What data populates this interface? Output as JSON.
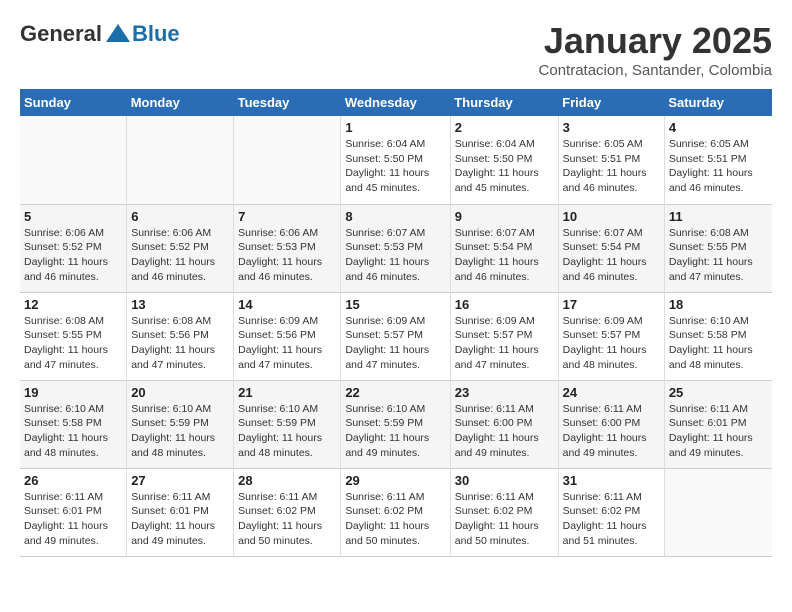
{
  "header": {
    "logo_text_general": "General",
    "logo_text_blue": "Blue",
    "title": "January 2025",
    "subtitle": "Contratacion, Santander, Colombia"
  },
  "days_of_week": [
    "Sunday",
    "Monday",
    "Tuesday",
    "Wednesday",
    "Thursday",
    "Friday",
    "Saturday"
  ],
  "weeks": [
    [
      {
        "day": "",
        "info": ""
      },
      {
        "day": "",
        "info": ""
      },
      {
        "day": "",
        "info": ""
      },
      {
        "day": "1",
        "info": "Sunrise: 6:04 AM\nSunset: 5:50 PM\nDaylight: 11 hours and 45 minutes."
      },
      {
        "day": "2",
        "info": "Sunrise: 6:04 AM\nSunset: 5:50 PM\nDaylight: 11 hours and 45 minutes."
      },
      {
        "day": "3",
        "info": "Sunrise: 6:05 AM\nSunset: 5:51 PM\nDaylight: 11 hours and 46 minutes."
      },
      {
        "day": "4",
        "info": "Sunrise: 6:05 AM\nSunset: 5:51 PM\nDaylight: 11 hours and 46 minutes."
      }
    ],
    [
      {
        "day": "5",
        "info": "Sunrise: 6:06 AM\nSunset: 5:52 PM\nDaylight: 11 hours and 46 minutes."
      },
      {
        "day": "6",
        "info": "Sunrise: 6:06 AM\nSunset: 5:52 PM\nDaylight: 11 hours and 46 minutes."
      },
      {
        "day": "7",
        "info": "Sunrise: 6:06 AM\nSunset: 5:53 PM\nDaylight: 11 hours and 46 minutes."
      },
      {
        "day": "8",
        "info": "Sunrise: 6:07 AM\nSunset: 5:53 PM\nDaylight: 11 hours and 46 minutes."
      },
      {
        "day": "9",
        "info": "Sunrise: 6:07 AM\nSunset: 5:54 PM\nDaylight: 11 hours and 46 minutes."
      },
      {
        "day": "10",
        "info": "Sunrise: 6:07 AM\nSunset: 5:54 PM\nDaylight: 11 hours and 46 minutes."
      },
      {
        "day": "11",
        "info": "Sunrise: 6:08 AM\nSunset: 5:55 PM\nDaylight: 11 hours and 47 minutes."
      }
    ],
    [
      {
        "day": "12",
        "info": "Sunrise: 6:08 AM\nSunset: 5:55 PM\nDaylight: 11 hours and 47 minutes."
      },
      {
        "day": "13",
        "info": "Sunrise: 6:08 AM\nSunset: 5:56 PM\nDaylight: 11 hours and 47 minutes."
      },
      {
        "day": "14",
        "info": "Sunrise: 6:09 AM\nSunset: 5:56 PM\nDaylight: 11 hours and 47 minutes."
      },
      {
        "day": "15",
        "info": "Sunrise: 6:09 AM\nSunset: 5:57 PM\nDaylight: 11 hours and 47 minutes."
      },
      {
        "day": "16",
        "info": "Sunrise: 6:09 AM\nSunset: 5:57 PM\nDaylight: 11 hours and 47 minutes."
      },
      {
        "day": "17",
        "info": "Sunrise: 6:09 AM\nSunset: 5:57 PM\nDaylight: 11 hours and 48 minutes."
      },
      {
        "day": "18",
        "info": "Sunrise: 6:10 AM\nSunset: 5:58 PM\nDaylight: 11 hours and 48 minutes."
      }
    ],
    [
      {
        "day": "19",
        "info": "Sunrise: 6:10 AM\nSunset: 5:58 PM\nDaylight: 11 hours and 48 minutes."
      },
      {
        "day": "20",
        "info": "Sunrise: 6:10 AM\nSunset: 5:59 PM\nDaylight: 11 hours and 48 minutes."
      },
      {
        "day": "21",
        "info": "Sunrise: 6:10 AM\nSunset: 5:59 PM\nDaylight: 11 hours and 48 minutes."
      },
      {
        "day": "22",
        "info": "Sunrise: 6:10 AM\nSunset: 5:59 PM\nDaylight: 11 hours and 49 minutes."
      },
      {
        "day": "23",
        "info": "Sunrise: 6:11 AM\nSunset: 6:00 PM\nDaylight: 11 hours and 49 minutes."
      },
      {
        "day": "24",
        "info": "Sunrise: 6:11 AM\nSunset: 6:00 PM\nDaylight: 11 hours and 49 minutes."
      },
      {
        "day": "25",
        "info": "Sunrise: 6:11 AM\nSunset: 6:01 PM\nDaylight: 11 hours and 49 minutes."
      }
    ],
    [
      {
        "day": "26",
        "info": "Sunrise: 6:11 AM\nSunset: 6:01 PM\nDaylight: 11 hours and 49 minutes."
      },
      {
        "day": "27",
        "info": "Sunrise: 6:11 AM\nSunset: 6:01 PM\nDaylight: 11 hours and 49 minutes."
      },
      {
        "day": "28",
        "info": "Sunrise: 6:11 AM\nSunset: 6:02 PM\nDaylight: 11 hours and 50 minutes."
      },
      {
        "day": "29",
        "info": "Sunrise: 6:11 AM\nSunset: 6:02 PM\nDaylight: 11 hours and 50 minutes."
      },
      {
        "day": "30",
        "info": "Sunrise: 6:11 AM\nSunset: 6:02 PM\nDaylight: 11 hours and 50 minutes."
      },
      {
        "day": "31",
        "info": "Sunrise: 6:11 AM\nSunset: 6:02 PM\nDaylight: 11 hours and 51 minutes."
      },
      {
        "day": "",
        "info": ""
      }
    ]
  ]
}
